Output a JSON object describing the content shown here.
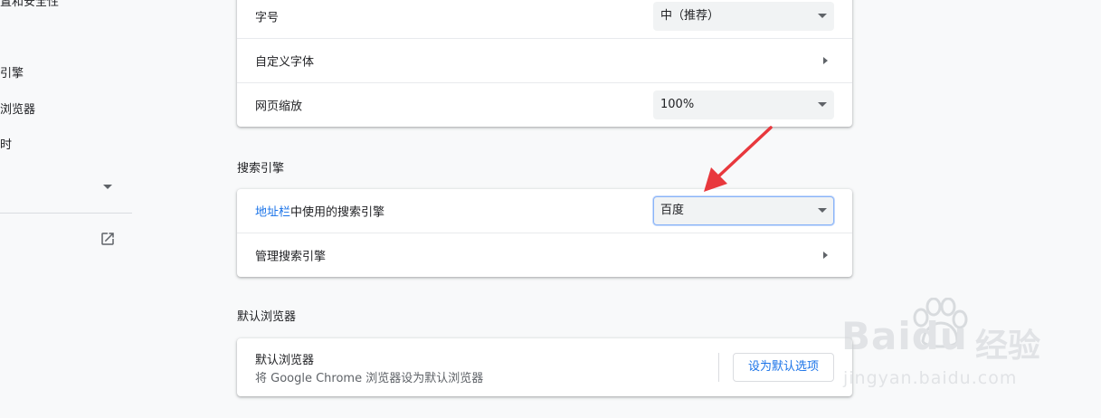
{
  "sidebar": {
    "items": [
      {
        "label": "置和安全性"
      },
      {
        "label": "引擎"
      },
      {
        "label": "浏览器"
      },
      {
        "label": "时"
      }
    ],
    "external_icon": "open-in-new-icon"
  },
  "appearance": {
    "font_size_label": "字号",
    "font_size_value": "中（推荐）",
    "custom_fonts_label": "自定义字体",
    "zoom_label": "网页缩放",
    "zoom_value": "100%"
  },
  "search_engine": {
    "section_title": "搜索引擎",
    "address_bar_link": "地址栏",
    "address_bar_rest": "中使用的搜索引擎",
    "engine_value": "百度",
    "manage_label": "管理搜索引擎"
  },
  "default_browser": {
    "section_title": "默认浏览器",
    "title": "默认浏览器",
    "subtitle": "将 Google Chrome 浏览器设为默认浏览器",
    "button": "设为默认选项"
  },
  "watermark": {
    "brand": "Baidu",
    "suffix": "经验",
    "url": "jingyan.baidu.com"
  },
  "colors": {
    "accent": "#1a73e8",
    "annotation_arrow": "#e8383d"
  }
}
